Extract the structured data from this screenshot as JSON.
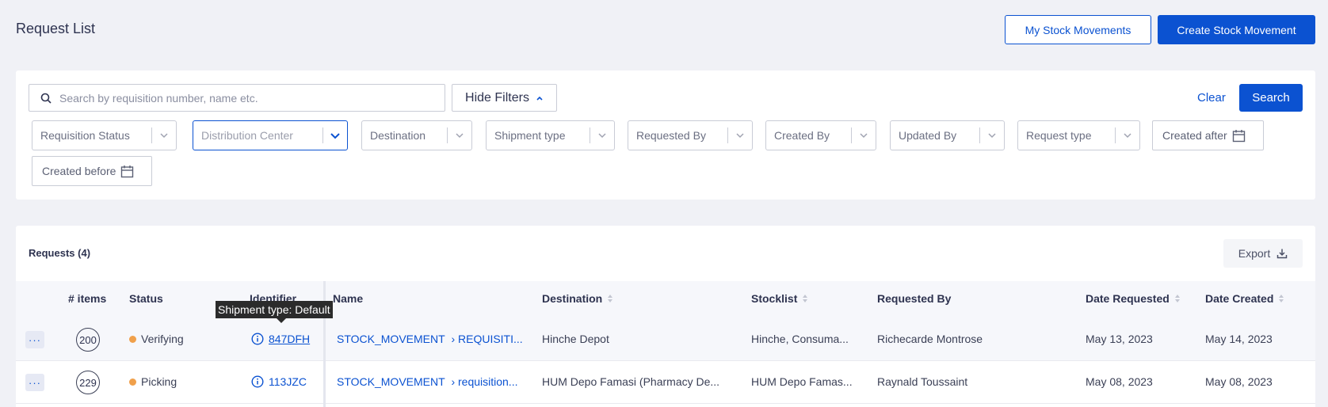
{
  "header": {
    "title": "Request List",
    "my_stock_movements": "My Stock Movements",
    "create_stock_movement": "Create Stock Movement"
  },
  "filters": {
    "search_placeholder": "Search by requisition number, name etc.",
    "hide_filters": "Hide Filters",
    "clear": "Clear",
    "search": "Search",
    "selects": {
      "requisition_status": "Requisition Status",
      "distribution_center": "Distribution Center",
      "destination": "Destination",
      "shipment_type": "Shipment type",
      "requested_by": "Requested By",
      "created_by": "Created By",
      "updated_by": "Updated By",
      "request_type": "Request type"
    },
    "created_after": "Created after",
    "created_before": "Created before"
  },
  "requests": {
    "title": "Requests (4)",
    "export": "Export",
    "columns": {
      "items": "# items",
      "status": "Status",
      "identifier": "Identifier",
      "name": "Name",
      "destination": "Destination",
      "stocklist": "Stocklist",
      "requested_by": "Requested By",
      "date_requested": "Date Requested",
      "date_created": "Date Created"
    },
    "rows": [
      {
        "actions": "···",
        "items": "200",
        "status": "Verifying",
        "identifier": "847DFH",
        "name_prefix": "STOCK_MOVEMENT",
        "name_suffix": "› REQUISITI...",
        "destination": "Hinche Depot",
        "stocklist": "Hinche, Consuma...",
        "requested_by": "Richecarde Montrose",
        "date_requested": "May 13, 2023",
        "date_created": "May 14, 2023"
      },
      {
        "actions": "···",
        "items": "229",
        "status": "Picking",
        "identifier": "113JZC",
        "name_prefix": "STOCK_MOVEMENT",
        "name_suffix": "› requisition...",
        "destination": "HUM Depo Famasi (Pharmacy De...",
        "stocklist": "HUM Depo Famas...",
        "requested_by": "Raynald Toussaint",
        "date_requested": "May 08, 2023",
        "date_created": "May 08, 2023"
      }
    ],
    "tooltip": "Shipment type: Default"
  },
  "colors": {
    "primary": "#0b52d1",
    "status_in_progress": "#f0a04b"
  }
}
